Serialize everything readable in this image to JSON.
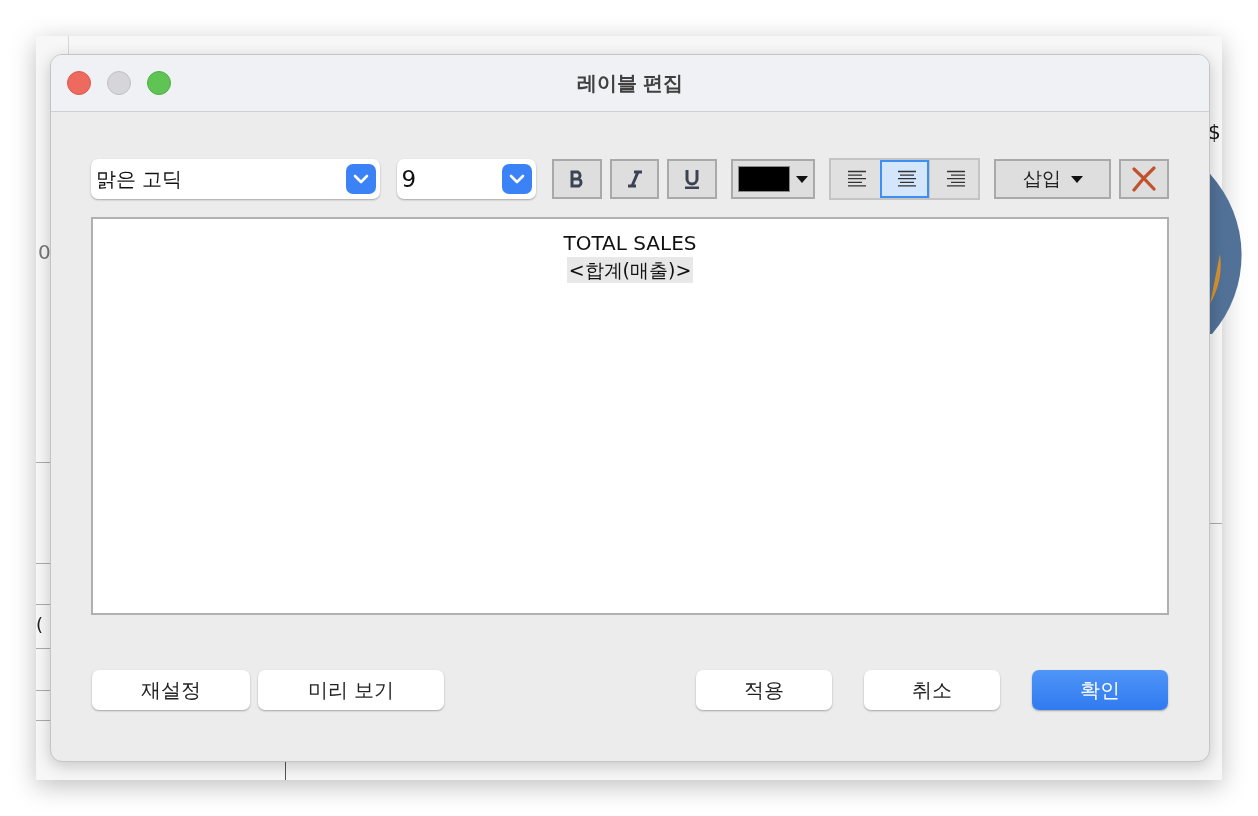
{
  "window": {
    "title": "레이블 편집"
  },
  "background": {
    "texts": [
      "0",
      "$",
      "("
    ]
  },
  "toolbar": {
    "font": "맑은 고딕",
    "size": "9",
    "color": "#000000",
    "align": [
      {
        "kind": "left",
        "selected": false
      },
      {
        "kind": "center",
        "selected": true
      },
      {
        "kind": "right",
        "selected": false
      }
    ],
    "insert": "삽입"
  },
  "editor": {
    "lines": [
      {
        "text": "TOTAL SALES",
        "field": false
      },
      {
        "text": "<합계(매출)>",
        "field": true
      }
    ]
  },
  "left_buttons": [
    {
      "label": "재설정",
      "primary": false
    },
    {
      "label": "미리 보기",
      "primary": false
    }
  ],
  "right_buttons": [
    {
      "label": "적용",
      "primary": false
    },
    {
      "label": "취소",
      "primary": false
    },
    {
      "label": "확인",
      "primary": true
    }
  ]
}
